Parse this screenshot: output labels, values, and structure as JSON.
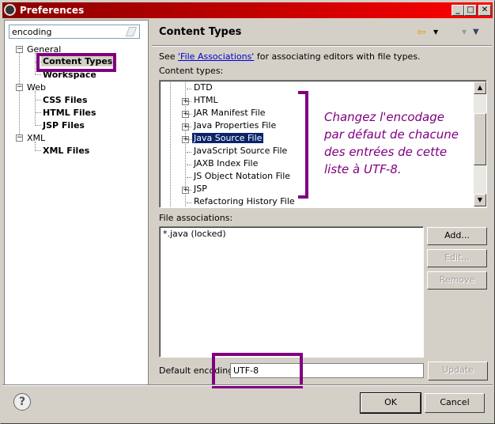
{
  "window": {
    "title": "Preferences",
    "minimize": "_",
    "maximize": "□",
    "close": "✕"
  },
  "filter": {
    "value": "encoding"
  },
  "nav_tree": [
    {
      "label": "General",
      "expanded": true,
      "children": [
        {
          "label": "Content Types",
          "selected": true
        },
        {
          "label": "Workspace"
        }
      ]
    },
    {
      "label": "Web",
      "expanded": true,
      "children": [
        {
          "label": "CSS Files"
        },
        {
          "label": "HTML Files"
        },
        {
          "label": "JSP Files"
        }
      ]
    },
    {
      "label": "XML",
      "expanded": true,
      "children": [
        {
          "label": "XML Files"
        }
      ]
    }
  ],
  "page": {
    "title": "Content Types",
    "see_prefix": "See ",
    "see_link": "'File Associations'",
    "see_suffix": " for associating editors with file types.",
    "content_types_label": "Content types:",
    "content_types": [
      {
        "label": "DTD",
        "expandable": false
      },
      {
        "label": "HTML",
        "expandable": true
      },
      {
        "label": "JAR Manifest File",
        "expandable": true
      },
      {
        "label": "Java Properties File",
        "expandable": true
      },
      {
        "label": "Java Source File",
        "expandable": true,
        "selected": true
      },
      {
        "label": "JavaScript Source File",
        "expandable": false
      },
      {
        "label": "JAXB Index File",
        "expandable": false
      },
      {
        "label": "JS Object Notation File",
        "expandable": false
      },
      {
        "label": "JSP",
        "expandable": true
      },
      {
        "label": "Refactoring History File",
        "expandable": false
      }
    ],
    "file_assoc_label": "File associations:",
    "file_assoc": [
      "*.java (locked)"
    ],
    "add": "Add...",
    "edit": "Edit...",
    "remove": "Remove",
    "default_encoding_label": "Default encoding:",
    "default_encoding": "UTF-8",
    "update": "Update"
  },
  "annotation": {
    "lines": [
      "Changez l'encodage",
      "par défaut de chacune",
      "des entrées de cette",
      "liste à UTF-8."
    ],
    "color": "#800080"
  },
  "footer": {
    "help": "?",
    "ok": "OK",
    "cancel": "Cancel"
  }
}
